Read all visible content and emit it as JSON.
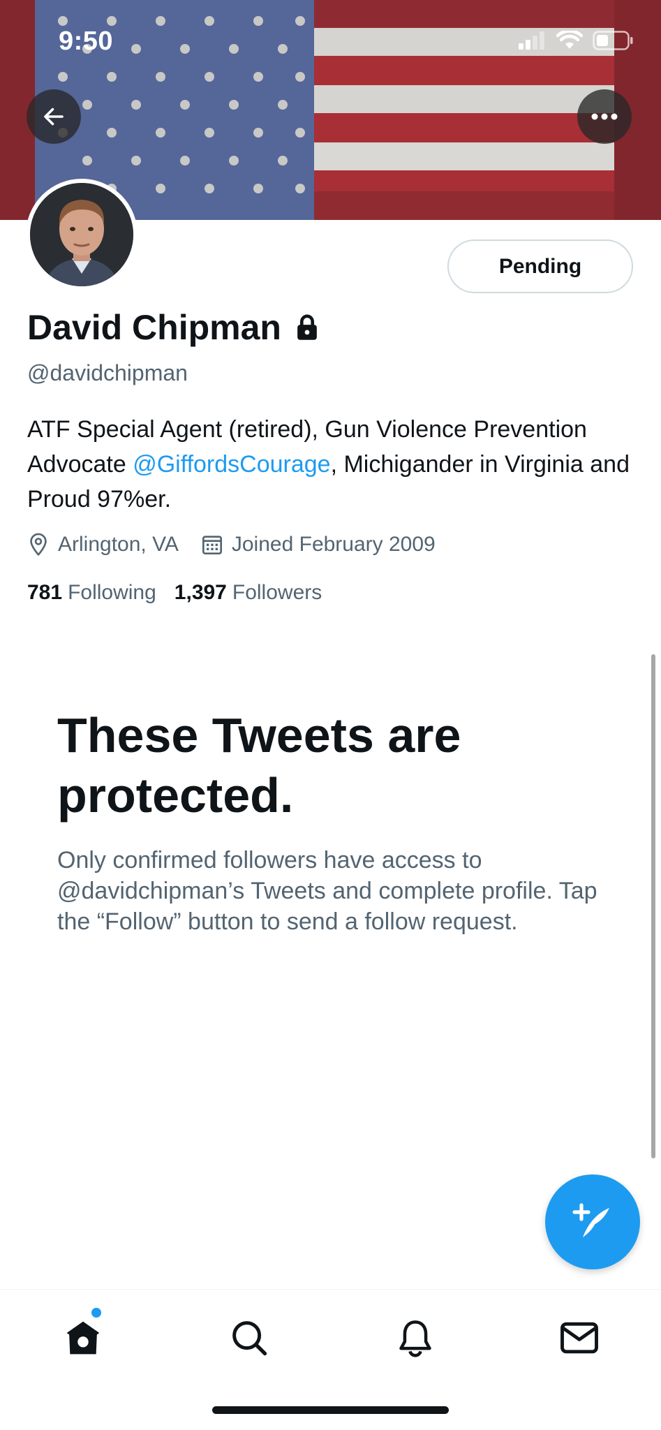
{
  "status_bar": {
    "time": "9:50"
  },
  "header": {
    "back_icon": "arrow-left-icon",
    "more_icon": "more-horizontal-icon"
  },
  "profile": {
    "name": "David Chipman",
    "handle": "@davidchipman",
    "follow_button_label": "Pending",
    "bio": {
      "part1": "ATF Special Agent (retired), Gun Violence Prevention Advocate ",
      "mention": "@GiffordsCourage",
      "part2": ", Michigander in Virginia and Proud 97%er."
    },
    "location": "Arlington, VA",
    "joined": "Joined February 2009",
    "following_count": "781",
    "following_label": "Following",
    "followers_count": "1,397",
    "followers_label": "Followers"
  },
  "protected_notice": {
    "title": "These Tweets are protected.",
    "body": "Only confirmed followers have access to @davidchipman’s Tweets and complete profile. Tap the “Follow” button to send a follow request."
  },
  "fab": {
    "icon": "compose-tweet-icon"
  },
  "bottom_nav": {
    "items": [
      "home-icon",
      "search-icon",
      "notifications-bell-icon",
      "messages-envelope-icon"
    ]
  },
  "colors": {
    "accent": "#1d9bf0",
    "text_primary": "#0f1419",
    "text_secondary": "#536471"
  }
}
